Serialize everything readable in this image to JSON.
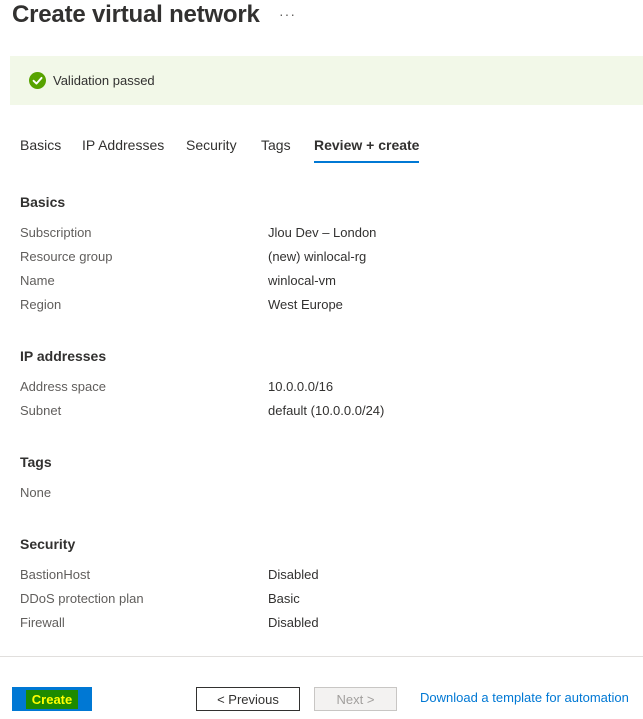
{
  "header": {
    "title": "Create virtual network",
    "more_label": "···"
  },
  "banner": {
    "text": "Validation passed",
    "icon": "checkmark-circle-icon",
    "color": "#57a300"
  },
  "tabs": [
    {
      "label": "Basics",
      "active": false
    },
    {
      "label": "IP Addresses",
      "active": false
    },
    {
      "label": "Security",
      "active": false
    },
    {
      "label": "Tags",
      "active": false
    },
    {
      "label": "Review + create",
      "active": true
    }
  ],
  "sections": {
    "basics": {
      "title": "Basics",
      "rows": [
        {
          "label": "Subscription",
          "value": "Jlou Dev – London"
        },
        {
          "label": "Resource group",
          "value": "(new) winlocal-rg"
        },
        {
          "label": "Name",
          "value": "winlocal-vm"
        },
        {
          "label": "Region",
          "value": "West Europe"
        }
      ]
    },
    "ip_addresses": {
      "title": "IP addresses",
      "rows": [
        {
          "label": "Address space",
          "value": "10.0.0.0/16"
        },
        {
          "label": "Subnet",
          "value": "default (10.0.0.0/24)"
        }
      ]
    },
    "tags": {
      "title": "Tags",
      "rows": [
        {
          "label": "None",
          "value": ""
        }
      ]
    },
    "security": {
      "title": "Security",
      "rows": [
        {
          "label": "BastionHost",
          "value": "Disabled"
        },
        {
          "label": "DDoS protection plan",
          "value": "Basic"
        },
        {
          "label": "Firewall",
          "value": "Disabled"
        }
      ]
    }
  },
  "footer": {
    "create_label": "Create",
    "previous_label": "< Previous",
    "next_label": "Next >",
    "download_label": "Download a template for automation"
  },
  "colors": {
    "accent": "#0078d4",
    "banner_bg": "#f2f8e8",
    "create_highlight": "#1d8a00",
    "create_highlight_text": "#ffff00"
  }
}
